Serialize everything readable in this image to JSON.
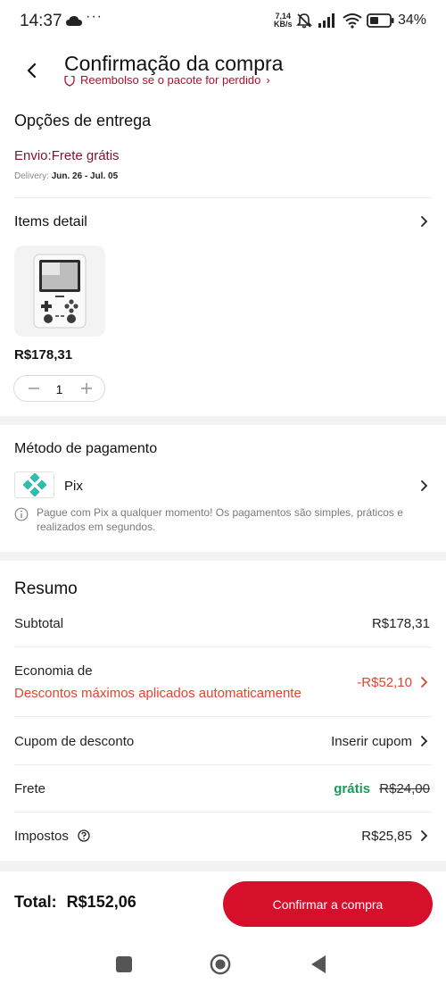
{
  "status_bar": {
    "time": "14:37",
    "more": "···",
    "net_speed_value": "7,14",
    "net_speed_unit": "KB/s",
    "battery_pct": "34%"
  },
  "header": {
    "title": "Confirmação da compra",
    "refund_text": "Reembolso se o pacote for perdido"
  },
  "delivery": {
    "section_title": "Opções de entrega",
    "shipping": "Envio:Frete grátis",
    "delivery_label": "Delivery:",
    "delivery_dates": "Jun. 26 - Jul. 05"
  },
  "items": {
    "section_title": "Items detail",
    "price": "R$178,31",
    "quantity": "1"
  },
  "payment": {
    "section_title": "Método de pagamento",
    "method": "Pix",
    "note": "Pague com Pix a qualquer momento! Os pagamentos são simples, práticos e realizados em segundos."
  },
  "summary": {
    "title": "Resumo",
    "subtotal_label": "Subtotal",
    "subtotal_value": "R$178,31",
    "savings_label": "Economia de",
    "savings_desc": "Descontos máximos aplicados automaticamente",
    "savings_value": "-R$52,10",
    "coupon_label": "Cupom de desconto",
    "coupon_action": "Inserir cupom",
    "shipping_label": "Frete",
    "shipping_free": "grátis",
    "shipping_old": "R$24,00",
    "taxes_label": "Impostos",
    "taxes_value": "R$25,85"
  },
  "footer": {
    "total_label": "Total:",
    "total_value": "R$152,06",
    "confirm_label": "Confirmar a compra"
  },
  "colors": {
    "accent_red": "#d6102a",
    "discount_orange": "#e0442c",
    "free_green": "#1a9a5a",
    "shipping_maroon": "#7a1530",
    "pix_teal": "#32bcad"
  },
  "icons": [
    "cloud-icon",
    "mute-bell-icon",
    "signal-icon",
    "wifi-icon",
    "battery-icon",
    "back-arrow-icon",
    "shield-icon",
    "chevron-right-icon",
    "minus-icon",
    "plus-icon",
    "pix-logo-icon",
    "info-icon",
    "help-icon",
    "square-nav-icon",
    "home-circle-nav-icon",
    "back-triangle-nav-icon"
  ]
}
